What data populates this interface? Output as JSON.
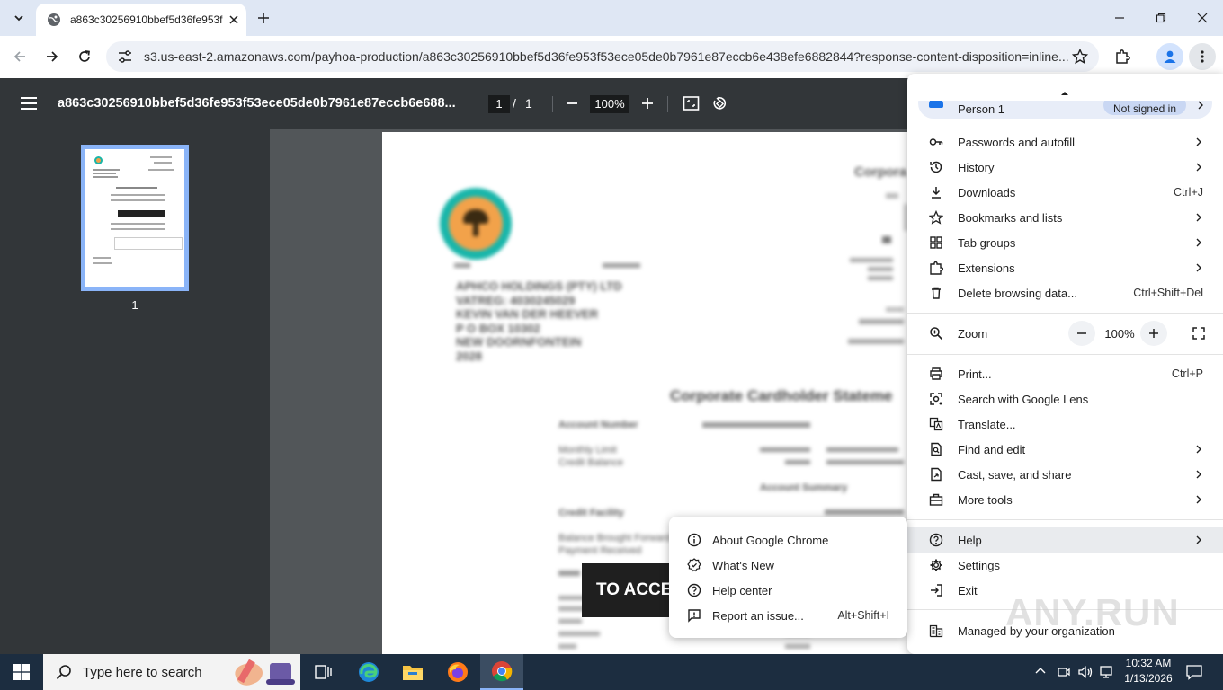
{
  "browser": {
    "tab_title": "a863c30256910bbef5d36fe953f",
    "url": "s3.us-east-2.amazonaws.com/payhoa-production/a863c30256910bbef5d36fe953f53ece05de0b7961e87eccb6e438efe6882844?response-content-disposition=inline..."
  },
  "pdf": {
    "filename": "a863c30256910bbef5d36fe953f53ece05de0b7961e87eccb6e688...",
    "page_current": "1",
    "page_sep": "/",
    "page_total": "1",
    "zoom": "100%",
    "thumb_label": "1",
    "doc_title": "Corporate Cardholder Stateme",
    "overlay_text": "TO ACCE",
    "address_lines": [
      "APHCO HOLDINGS (PTY) LTD",
      "VATREG: 4030245029",
      "KEVIN VAN DER HEEVER",
      "P O BOX 10302",
      "NEW DOORNFONTEIN",
      "2028"
    ],
    "header_right": "Corpora",
    "fields": [
      "Account Number",
      "Monthly Limit",
      "Credit Balance",
      "Account Summary",
      "Credit Facility",
      "Balance Brought Forward",
      "Payment Received"
    ]
  },
  "menu": {
    "profile_name": "Person 1",
    "profile_status": "Not signed in",
    "items": [
      {
        "label": "Passwords and autofill",
        "shortcut": ""
      },
      {
        "label": "History",
        "shortcut": ""
      },
      {
        "label": "Downloads",
        "shortcut": "Ctrl+J"
      },
      {
        "label": "Bookmarks and lists",
        "shortcut": ""
      },
      {
        "label": "Tab groups",
        "shortcut": ""
      },
      {
        "label": "Extensions",
        "shortcut": ""
      },
      {
        "label": "Delete browsing data...",
        "shortcut": "Ctrl+Shift+Del"
      }
    ],
    "zoom_label": "Zoom",
    "zoom_value": "100%",
    "items2": [
      {
        "label": "Print...",
        "shortcut": "Ctrl+P"
      },
      {
        "label": "Search with Google Lens",
        "shortcut": ""
      },
      {
        "label": "Translate...",
        "shortcut": ""
      },
      {
        "label": "Find and edit",
        "shortcut": ""
      },
      {
        "label": "Cast, save, and share",
        "shortcut": ""
      },
      {
        "label": "More tools",
        "shortcut": ""
      }
    ],
    "help": "Help",
    "settings": "Settings",
    "exit": "Exit",
    "managed": "Managed by your organization"
  },
  "help_submenu": {
    "items": [
      {
        "label": "About Google Chrome",
        "shortcut": ""
      },
      {
        "label": "What's New",
        "shortcut": ""
      },
      {
        "label": "Help center",
        "shortcut": ""
      },
      {
        "label": "Report an issue...",
        "shortcut": "Alt+Shift+I"
      }
    ]
  },
  "taskbar": {
    "search_placeholder": "Type here to search",
    "time": "10:32 AM",
    "date": "1/13/2026"
  },
  "watermark": "ANY.RUN",
  "colors": {
    "accent": "#1a73e8",
    "pdf_toolbar": "#323639",
    "viewer_bg": "#525659",
    "taskbar": "#1c2d40"
  }
}
